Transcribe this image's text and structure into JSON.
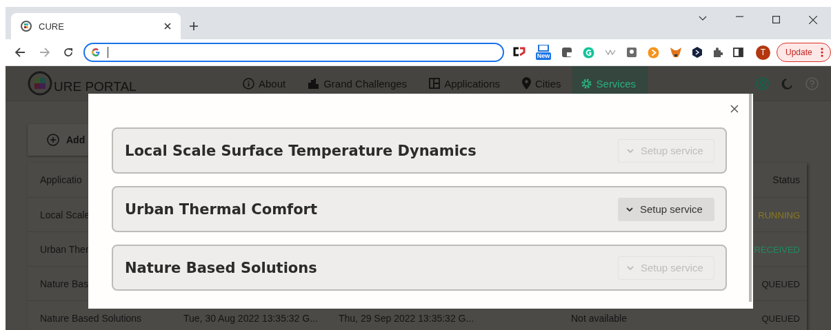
{
  "browser": {
    "tab_title": "CURE",
    "extension_badge": "New",
    "avatar": "T",
    "update_button": "Update"
  },
  "navbar": {
    "logo_text": "URE PORTAL",
    "items": [
      {
        "label": "About",
        "selected": false
      },
      {
        "label": "Grand Challenges",
        "selected": false
      },
      {
        "label": "Applications",
        "selected": false
      },
      {
        "label": "Cities",
        "selected": false
      },
      {
        "label": "Services",
        "selected": true
      }
    ]
  },
  "add_button": "Add",
  "table": {
    "header": {
      "application": "Applicatio",
      "status": "Status"
    },
    "rows": [
      {
        "application": "Local Scale",
        "status": "RUNNING",
        "color": "#8c7a22"
      },
      {
        "application": "Urban Ther",
        "status": "RECEIVED",
        "color": "#1f8a62"
      },
      {
        "application": "Nature Bas",
        "status": "QUEUED",
        "color": "#141414"
      },
      {
        "application": "Nature Based Solutions",
        "created": "Tue, 30 Aug 2022 13:35:32 G...",
        "expires": "Thu, 29 Sep 2022 13:35:32 G...",
        "output": "Not available",
        "status": "QUEUED",
        "color": "#141414"
      }
    ]
  },
  "modal": {
    "services": [
      {
        "title": "Local Scale Surface Temperature Dynamics",
        "button": "Setup service",
        "disabled": true
      },
      {
        "title": "Urban Thermal Comfort",
        "button": "Setup service",
        "disabled": false
      },
      {
        "title": "Nature Based Solutions",
        "button": "Setup service",
        "disabled": true
      }
    ]
  }
}
